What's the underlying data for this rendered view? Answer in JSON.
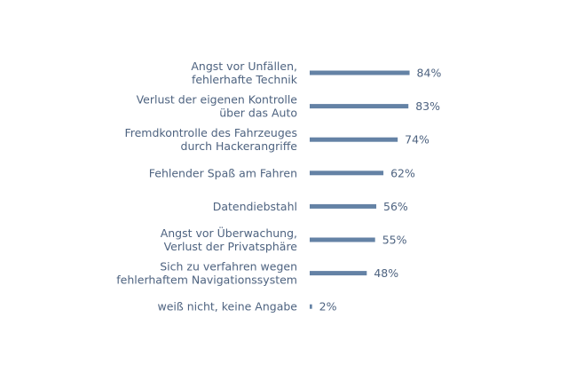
{
  "chart_data": {
    "type": "bar",
    "orientation": "horizontal",
    "title": "",
    "xlabel": "",
    "ylabel": "",
    "categories": [
      [
        "Angst vor Unfällen,",
        "fehlerhafte Technik"
      ],
      [
        "Verlust der eigenen Kontrolle",
        "über das Auto"
      ],
      [
        "Fremdkontrolle des Fahrzeuges",
        "durch Hackerangriffe"
      ],
      [
        "Fehlender Spaß am Fahren"
      ],
      [
        "Datendiebstahl"
      ],
      [
        "Angst vor Überwachung,",
        "Verlust der Privatsphäre"
      ],
      [
        "Sich zu verfahren wegen",
        "fehlerhaftem Navigationssystem"
      ],
      [
        "weiß nicht, keine Angabe"
      ]
    ],
    "values": [
      84,
      83,
      74,
      62,
      56,
      55,
      48,
      2
    ],
    "value_labels": [
      "84%",
      "83%",
      "74%",
      "62%",
      "56%",
      "55%",
      "48%",
      "2%"
    ],
    "xlim": [
      0,
      100
    ],
    "grid": false,
    "legend": "none",
    "bar_color": "#6482a5",
    "text_color": "#4e6380"
  }
}
